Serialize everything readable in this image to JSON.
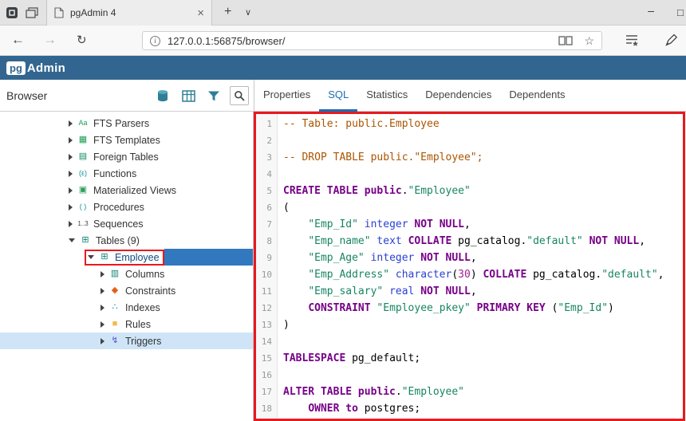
{
  "browser_chrome": {
    "tab": {
      "title": "pgAdmin 4",
      "close_glyph": "×"
    },
    "new_tab_glyph": "+",
    "tab_dropdown_glyph": "∨",
    "window_controls": {
      "minimize": "–",
      "maximize": "□"
    },
    "nav": {
      "back": "←",
      "forward": "→",
      "refresh": "↻",
      "star": "☆",
      "info": "i"
    },
    "address": {
      "url": "127.0.0.1:56875/browser/"
    }
  },
  "app_header": {
    "logo_pg": "pg",
    "logo_admin": "Admin",
    "brand_color": "#326690"
  },
  "toolbar": {
    "browser_label": "Browser",
    "tabs": [
      {
        "label": "Properties",
        "active": false
      },
      {
        "label": "SQL",
        "active": true
      },
      {
        "label": "Statistics",
        "active": false
      },
      {
        "label": "Dependencies",
        "active": false
      },
      {
        "label": "Dependents",
        "active": false
      }
    ]
  },
  "tree": {
    "items": [
      {
        "label": "FTS Parsers",
        "level": 0,
        "chevron": "right",
        "icon": "fts-parsers-icon",
        "glyph": "Aa",
        "glyph_color": "#1e9e53",
        "glyph_size": 9
      },
      {
        "label": "FTS Templates",
        "level": 0,
        "chevron": "right",
        "icon": "fts-templates-icon",
        "glyph": "▦",
        "glyph_color": "#1e9e53"
      },
      {
        "label": "Foreign Tables",
        "level": 0,
        "chevron": "right",
        "icon": "foreign-tables-icon",
        "glyph": "▤",
        "glyph_color": "#128a66"
      },
      {
        "label": "Functions",
        "level": 0,
        "chevron": "right",
        "icon": "functions-icon",
        "glyph": "(ε)",
        "glyph_color": "#0e8e99",
        "glyph_size": 9
      },
      {
        "label": "Materialized Views",
        "level": 0,
        "chevron": "right",
        "icon": "materialized-views-icon",
        "glyph": "▣",
        "glyph_color": "#2aa05c"
      },
      {
        "label": "Procedures",
        "level": 0,
        "chevron": "right",
        "icon": "procedures-icon",
        "glyph": "( )",
        "glyph_color": "#0e8e99",
        "glyph_size": 9
      },
      {
        "label": "Sequences",
        "level": 0,
        "chevron": "right",
        "icon": "sequences-icon",
        "glyph": "1..3",
        "glyph_color": "#444",
        "glyph_size": 8
      },
      {
        "label": "Tables (9)",
        "level": 0,
        "chevron": "down",
        "icon": "tables-icon",
        "glyph": "⊞",
        "glyph_color": "#0e8573"
      },
      {
        "label": "Employee",
        "level": 1,
        "chevron": "down",
        "icon": "table-icon",
        "glyph": "⊞",
        "glyph_color": "#0e8573",
        "selected": true,
        "annotated": true
      },
      {
        "label": "Columns",
        "level": 2,
        "chevron": "right",
        "icon": "columns-icon",
        "glyph": "▥",
        "glyph_color": "#0e8573"
      },
      {
        "label": "Constraints",
        "level": 2,
        "chevron": "right",
        "icon": "constraints-icon",
        "glyph": "◆",
        "glyph_color": "#e2611b"
      },
      {
        "label": "Indexes",
        "level": 2,
        "chevron": "right",
        "icon": "indexes-icon",
        "glyph": "∴",
        "glyph_color": "#0f8ea0"
      },
      {
        "label": "Rules",
        "level": 2,
        "chevron": "right",
        "icon": "rules-icon",
        "glyph": "■",
        "glyph_color": "#eebc4a"
      },
      {
        "label": "Triggers",
        "level": 2,
        "chevron": "right",
        "icon": "triggers-icon",
        "glyph": "↯",
        "glyph_color": "#5555cc",
        "highlighted": true
      }
    ]
  },
  "sql": {
    "lines": [
      [
        [
          "com",
          "-- Table: public.Employee"
        ]
      ],
      [],
      [
        [
          "com",
          "-- DROP TABLE public.\"Employee\";"
        ]
      ],
      [],
      [
        [
          "kw",
          "CREATE TABLE public"
        ],
        [
          "pln",
          "."
        ],
        [
          "str",
          "\"Employee\""
        ]
      ],
      [
        [
          "pln",
          "("
        ]
      ],
      [
        [
          "pln",
          "    "
        ],
        [
          "str",
          "\"Emp_Id\""
        ],
        [
          "pln",
          " "
        ],
        [
          "typ",
          "integer"
        ],
        [
          "pln",
          " "
        ],
        [
          "kw",
          "NOT NULL"
        ],
        [
          "pln",
          ","
        ]
      ],
      [
        [
          "pln",
          "    "
        ],
        [
          "str",
          "\"Emp_name\""
        ],
        [
          "pln",
          " "
        ],
        [
          "typ",
          "text"
        ],
        [
          "pln",
          " "
        ],
        [
          "kw",
          "COLLATE"
        ],
        [
          "pln",
          " pg_catalog."
        ],
        [
          "str",
          "\"default\""
        ],
        [
          "pln",
          " "
        ],
        [
          "kw",
          "NOT NULL"
        ],
        [
          "pln",
          ","
        ]
      ],
      [
        [
          "pln",
          "    "
        ],
        [
          "str",
          "\"Emp_Age\""
        ],
        [
          "pln",
          " "
        ],
        [
          "typ",
          "integer"
        ],
        [
          "pln",
          " "
        ],
        [
          "kw",
          "NOT NULL"
        ],
        [
          "pln",
          ","
        ]
      ],
      [
        [
          "pln",
          "    "
        ],
        [
          "str",
          "\"Emp_Address\""
        ],
        [
          "pln",
          " "
        ],
        [
          "typ",
          "character"
        ],
        [
          "pln",
          "("
        ],
        [
          "num",
          "30"
        ],
        [
          "pln",
          ") "
        ],
        [
          "kw",
          "COLLATE"
        ],
        [
          "pln",
          " pg_catalog."
        ],
        [
          "str",
          "\"default\""
        ],
        [
          "pln",
          ","
        ]
      ],
      [
        [
          "pln",
          "    "
        ],
        [
          "str",
          "\"Emp_salary\""
        ],
        [
          "pln",
          " "
        ],
        [
          "typ",
          "real"
        ],
        [
          "pln",
          " "
        ],
        [
          "kw",
          "NOT NULL"
        ],
        [
          "pln",
          ","
        ]
      ],
      [
        [
          "pln",
          "    "
        ],
        [
          "kw",
          "CONSTRAINT"
        ],
        [
          "pln",
          " "
        ],
        [
          "str",
          "\"Employee_pkey\""
        ],
        [
          "pln",
          " "
        ],
        [
          "kw",
          "PRIMARY KEY"
        ],
        [
          "pln",
          " ("
        ],
        [
          "str",
          "\"Emp_Id\""
        ],
        [
          "pln",
          ")"
        ]
      ],
      [
        [
          "pln",
          ")"
        ]
      ],
      [],
      [
        [
          "kw",
          "TABLESPACE"
        ],
        [
          "pln",
          " pg_default;"
        ]
      ],
      [],
      [
        [
          "kw",
          "ALTER TABLE public"
        ],
        [
          "pln",
          "."
        ],
        [
          "str",
          "\"Employee\""
        ]
      ],
      [
        [
          "pln",
          "    "
        ],
        [
          "kw",
          "OWNER to"
        ],
        [
          "pln",
          " postgres;"
        ]
      ]
    ]
  },
  "annotations": {
    "highlight_color": "#e8191f"
  }
}
